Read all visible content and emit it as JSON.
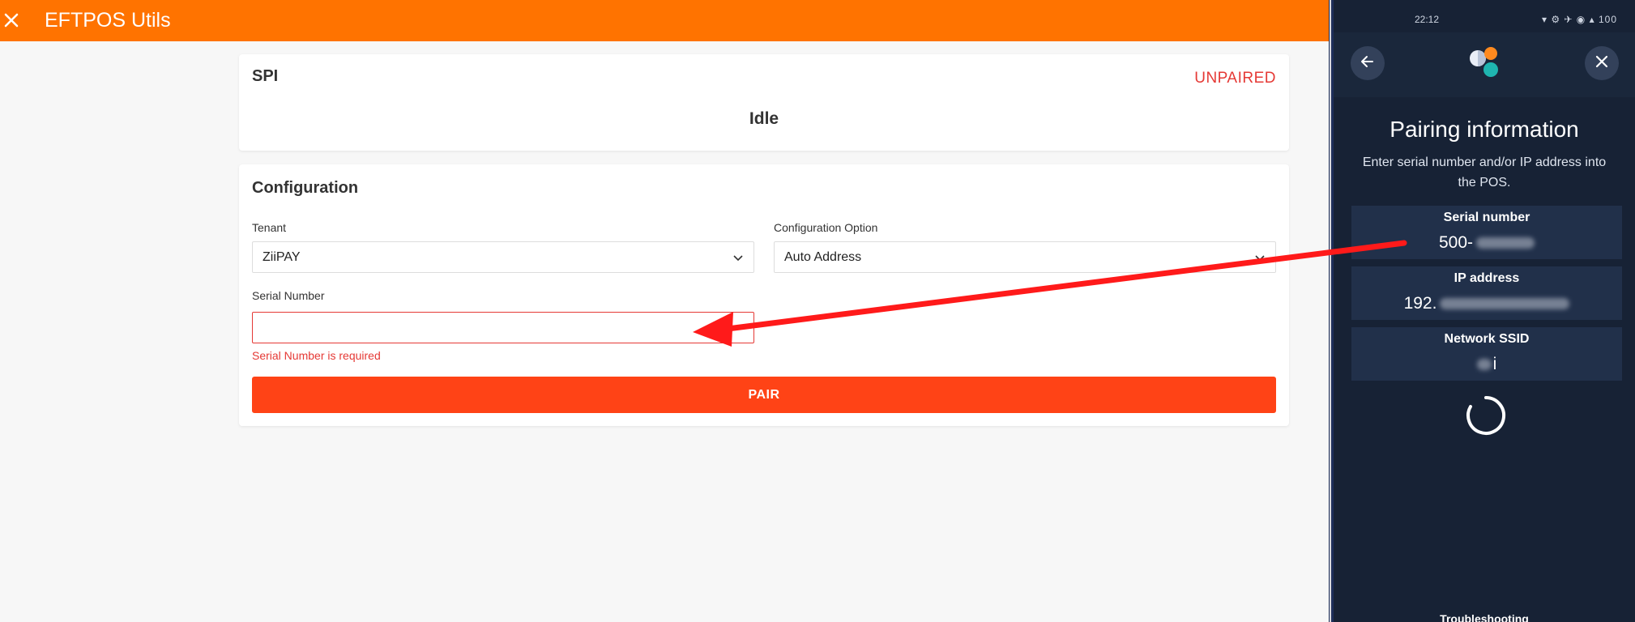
{
  "app": {
    "title": "EFTPOS Utils",
    "close_icon": "close-icon",
    "accent_color": "#ff7300"
  },
  "spi": {
    "title": "SPI",
    "status": "UNPAIRED",
    "state": "Idle",
    "status_color": "#e53935"
  },
  "config": {
    "title": "Configuration",
    "tenant": {
      "label": "Tenant",
      "value": "ZiiPAY"
    },
    "option": {
      "label": "Configuration Option",
      "value": "Auto Address"
    },
    "serial": {
      "label": "Serial Number",
      "value": "",
      "error": "Serial Number is required"
    },
    "pair_label": "PAIR",
    "pair_color": "#ff4316"
  },
  "phone": {
    "status_time": "22:12",
    "status_right": "▾ ⚙ ✈ ◉ ▴ 100",
    "title": "Pairing information",
    "description": "Enter serial number and/or IP address into the POS.",
    "serial": {
      "label": "Serial number",
      "value_prefix": "500-"
    },
    "ip": {
      "label": "IP address",
      "value_prefix": "192."
    },
    "ssid": {
      "label": "Network SSID",
      "value_suffix": "i"
    },
    "troubleshooting": "Troubleshooting",
    "bg_color": "#172235"
  }
}
